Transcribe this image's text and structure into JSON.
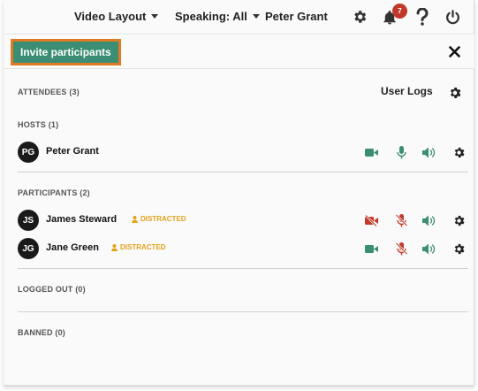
{
  "topbar": {
    "video_layout": "Video Layout",
    "speaking": "Speaking: All",
    "user_name": "Peter Grant",
    "notification_count": "7"
  },
  "invite": {
    "label": "Invite participants"
  },
  "attendees": {
    "label": "ATTENDEES (3)",
    "user_logs": "User Logs"
  },
  "hosts": {
    "label": "HOSTS (1)",
    "items": [
      {
        "initials": "PG",
        "name": "Peter Grant"
      }
    ]
  },
  "participants": {
    "label": "PARTICIPANTS (2)",
    "items": [
      {
        "initials": "JS",
        "name": "James Steward",
        "status": "DISTRACTED",
        "camera": "off",
        "mic": "muted",
        "speaker": "on"
      },
      {
        "initials": "JG",
        "name": "Jane Green",
        "status": "DISTRACTED",
        "camera": "on",
        "mic": "muted",
        "speaker": "on"
      }
    ]
  },
  "logged_out": {
    "label": "LOGGED OUT (0)"
  },
  "banned": {
    "label": "BANNED (0)"
  },
  "colors": {
    "accent_green": "#3b8e74",
    "highlight_orange": "#e07b24",
    "status_amber": "#e3a21a",
    "muted_red": "#c0392b",
    "badge_red": "#c0392b"
  }
}
